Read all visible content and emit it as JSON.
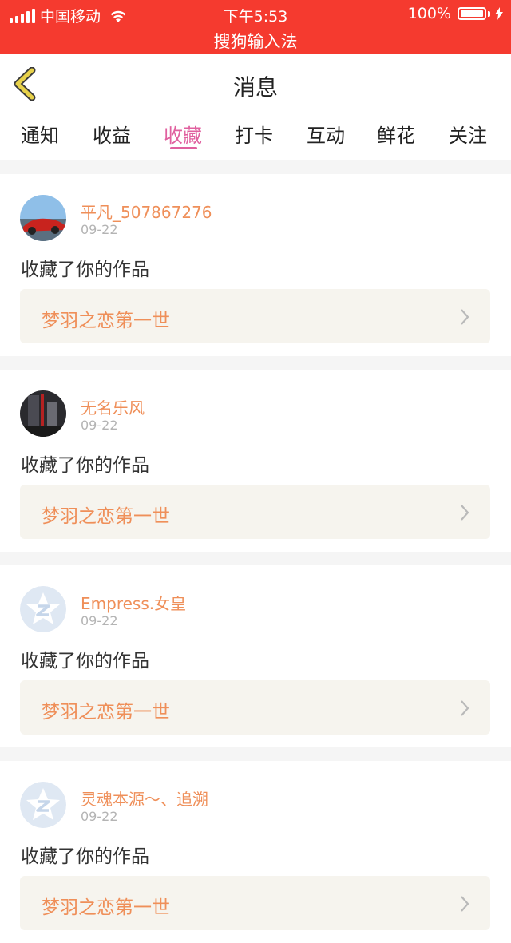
{
  "status_bar": {
    "carrier": "中国移动",
    "time": "下午5:53",
    "battery": "100%",
    "ime_label": "搜狗输入法"
  },
  "nav": {
    "title": "消息"
  },
  "tabs": [
    {
      "label": "通知"
    },
    {
      "label": "收益"
    },
    {
      "label": "收藏"
    },
    {
      "label": "打卡"
    },
    {
      "label": "互动"
    },
    {
      "label": "鲜花"
    },
    {
      "label": "关注"
    }
  ],
  "active_tab": "收藏",
  "messages": [
    {
      "user": "平凡_507867276",
      "date": "09-22",
      "action": "收藏了你的作品",
      "work": "梦羽之恋第一世",
      "avatar": "red-car-photo"
    },
    {
      "user": "无名乐风",
      "date": "09-22",
      "action": "收藏了你的作品",
      "work": "梦羽之恋第一世",
      "avatar": "dark-photo"
    },
    {
      "user": "Empress.女皇",
      "date": "09-22",
      "action": "收藏了你的作品",
      "work": "梦羽之恋第一世",
      "avatar": "default-avatar-icon"
    },
    {
      "user": "灵魂本源～、追溯",
      "date": "09-22",
      "action": "收藏了你的作品",
      "work": "梦羽之恋第一世",
      "avatar": "default-avatar-icon"
    }
  ],
  "colors": {
    "status_bar": "#f53a2f",
    "accent_pink": "#e0609f",
    "username_orange": "#ef8f59",
    "back_arrow": "#e8d24a"
  }
}
